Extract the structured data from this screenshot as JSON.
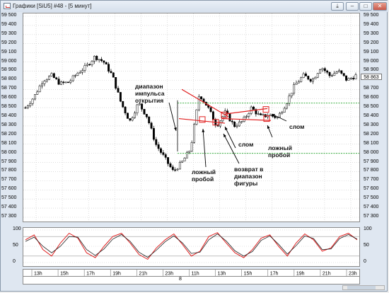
{
  "window": {
    "title": "Графики [SiU5] #48 - [5 минут]",
    "accent": "#d0d9e6"
  },
  "price_axis": {
    "labels": [
      "59 500",
      "59 400",
      "59 300",
      "59 200",
      "59 100",
      "59 000",
      "58 900",
      "58 800",
      "58 700",
      "58 600",
      "58 500",
      "58 400",
      "58 300",
      "58 200",
      "58 100",
      "58 000",
      "57 900",
      "57 800",
      "57 700",
      "57 600",
      "57 500",
      "57 400",
      "57 300"
    ],
    "current_price": "58 863"
  },
  "oscillator_axis": {
    "labels": [
      "100",
      "50",
      "0"
    ]
  },
  "time_axis": {
    "labels": [
      "13h",
      "15h",
      "17h",
      "19h",
      "21h",
      "23h",
      "11h",
      "13h",
      "15h",
      "17h",
      "19h",
      "21h",
      "23h"
    ]
  },
  "period_label": "8",
  "annotations": {
    "impulse_range": [
      "диапазон",
      "импульса",
      "открытия"
    ],
    "false_breakout_1": [
      "ложный",
      "пробой"
    ],
    "return_to_range": [
      "возврат в",
      "диапазон",
      "фигуры"
    ],
    "break_1": "слом",
    "false_breakout_2": [
      "ложный",
      "пробой"
    ],
    "break_2": "слом"
  },
  "colors": {
    "trend_lines": "#e02020",
    "levels": "#3cb043",
    "osc_fast": "#e02020",
    "osc_slow": "#202020"
  },
  "chart_data": {
    "type": "candlestick",
    "ylim": [
      57300,
      59500
    ],
    "x": [
      "13h",
      "15h",
      "17h",
      "19h",
      "21h",
      "23h",
      "11h",
      "13h",
      "15h",
      "17h",
      "19h",
      "21h",
      "23h"
    ],
    "close_path": [
      [
        0,
        58500
      ],
      [
        1,
        58620
      ],
      [
        2,
        58800
      ],
      [
        3,
        58850
      ],
      [
        4,
        58760
      ],
      [
        5,
        58780
      ],
      [
        6,
        58880
      ],
      [
        7,
        58950
      ],
      [
        8,
        59060
      ],
      [
        9,
        59000
      ],
      [
        10,
        58850
      ],
      [
        11,
        58550
      ],
      [
        12,
        58350
      ],
      [
        13,
        58550
      ],
      [
        14,
        58400
      ],
      [
        15,
        58100
      ],
      [
        16,
        57950
      ],
      [
        17,
        57800
      ],
      [
        18,
        57900
      ],
      [
        19,
        58050
      ],
      [
        20,
        58650
      ],
      [
        21,
        58500
      ],
      [
        22,
        58300
      ],
      [
        23,
        58450
      ],
      [
        24,
        58300
      ],
      [
        25,
        58350
      ],
      [
        26,
        58500
      ],
      [
        27,
        58400
      ],
      [
        28,
        58420
      ],
      [
        29,
        58390
      ],
      [
        30,
        58550
      ],
      [
        31,
        58750
      ],
      [
        32,
        58850
      ],
      [
        33,
        58800
      ],
      [
        34,
        58950
      ],
      [
        35,
        58850
      ],
      [
        36,
        58900
      ],
      [
        37,
        58800
      ],
      [
        38,
        58850
      ]
    ],
    "levels": [
      58550,
      58000
    ],
    "oscillator": {
      "ylim": [
        0,
        100
      ],
      "series": [
        {
          "values": [
            70,
            85,
            40,
            20,
            60,
            90,
            75,
            30,
            15,
            50,
            80,
            90,
            60,
            25,
            10,
            45,
            70,
            88,
            55,
            20,
            35,
            80,
            92,
            60,
            30,
            15,
            40,
            75,
            85,
            50,
            20,
            60,
            88,
            70,
            35,
            45,
            80,
            90,
            70
          ]
        },
        {
          "values": [
            65,
            78,
            50,
            30,
            50,
            80,
            78,
            40,
            22,
            42,
            72,
            86,
            65,
            32,
            16,
            38,
            64,
            82,
            60,
            28,
            32,
            70,
            88,
            66,
            36,
            20,
            34,
            68,
            82,
            56,
            26,
            52,
            82,
            74,
            40,
            42,
            74,
            86,
            72
          ]
        }
      ]
    }
  }
}
